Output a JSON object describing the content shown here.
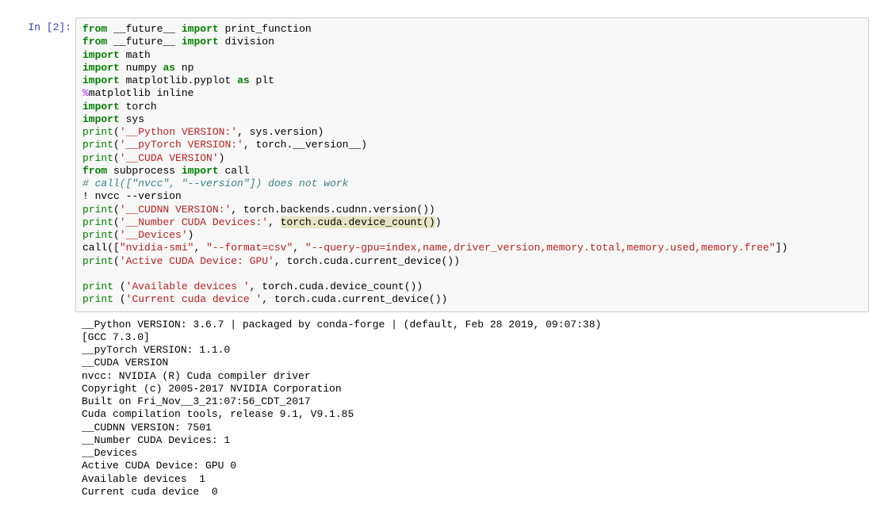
{
  "cell": {
    "prompt": "In [2]:",
    "code": {
      "l1": {
        "kw1": "from",
        "mod": "__future__",
        "kw2": "import",
        "name": "print_function"
      },
      "l2": {
        "kw1": "from",
        "mod": "__future__",
        "kw2": "import",
        "name": "division"
      },
      "l3": {
        "kw": "import",
        "mod": "math"
      },
      "l4": {
        "kw": "import",
        "mod": "numpy",
        "as": "as",
        "alias": "np"
      },
      "l5": {
        "kw": "import",
        "mod": "matplotlib.pyplot",
        "as": "as",
        "alias": "plt"
      },
      "l6": {
        "magic": "%",
        "rest": "matplotlib inline"
      },
      "l7": {
        "kw": "import",
        "mod": "torch"
      },
      "l8": {
        "kw": "import",
        "mod": "sys"
      },
      "l9": {
        "fn": "print",
        "p1": "(",
        "s": "'__Python VERSION:'",
        "c": ", sys.version)",
        "close": ""
      },
      "l10": {
        "fn": "print",
        "p1": "(",
        "s": "'__pyTorch VERSION:'",
        "c": ", torch.__version__)"
      },
      "l11": {
        "fn": "print",
        "p1": "(",
        "s": "'__CUDA VERSION'",
        "c": ")"
      },
      "l12": {
        "kw1": "from",
        "mod": "subprocess",
        "kw2": "import",
        "name": "call"
      },
      "l13": {
        "comment": "# call([\"nvcc\", \"--version\"]) does not work"
      },
      "l14": {
        "bang": "!",
        "rest": " nvcc --version"
      },
      "l15": {
        "fn": "print",
        "p": "(",
        "s": "'__CUDNN VERSION:'",
        "c": ", torch.backends.cudnn.version())"
      },
      "l16": {
        "fn": "print",
        "p": "(",
        "s": "'__Number CUDA Devices:'",
        "c1": ", ",
        "hl": "torch.cuda.device_count()",
        "c2": ")"
      },
      "l17": {
        "fn": "print",
        "p": "(",
        "s": "'__Devices'",
        "c": ")"
      },
      "l18": {
        "fn": "call",
        "p": "([",
        "s1": "\"nvidia-smi\"",
        "c1": ", ",
        "s2": "\"--format=csv\"",
        "c2": ", ",
        "s3": "\"--query-gpu=index,name,driver_version,memory.total,memory.used,memory.free\"",
        "c3": "])"
      },
      "l19": {
        "fn": "print",
        "p": "(",
        "s": "'Active CUDA Device: GPU'",
        "c": ", torch.cuda.current_device())"
      },
      "l20": {
        "blank": " "
      },
      "l21": {
        "fn": "print",
        "sp": " ",
        "p": "(",
        "s": "'Available devices '",
        "c": ", torch.cuda.device_count())"
      },
      "l22": {
        "fn": "print",
        "sp": " ",
        "p": "(",
        "s": "'Current cuda device '",
        "c": ", torch.cuda.current_device())"
      }
    },
    "output": {
      "o1": "__Python VERSION: 3.6.7 | packaged by conda-forge | (default, Feb 28 2019, 09:07:38) ",
      "o2": "[GCC 7.3.0]",
      "o3": "__pyTorch VERSION: 1.1.0",
      "o4": "__CUDA VERSION",
      "o5": "nvcc: NVIDIA (R) Cuda compiler driver",
      "o6": "Copyright (c) 2005-2017 NVIDIA Corporation",
      "o7": "Built on Fri_Nov__3_21:07:56_CDT_2017",
      "o8": "Cuda compilation tools, release 9.1, V9.1.85",
      "o9": "__CUDNN VERSION: 7501",
      "o10": "__Number CUDA Devices: 1",
      "o11": "__Devices",
      "o12": "Active CUDA Device: GPU 0",
      "o13": "Available devices  1",
      "o14": "Current cuda device  0"
    }
  }
}
